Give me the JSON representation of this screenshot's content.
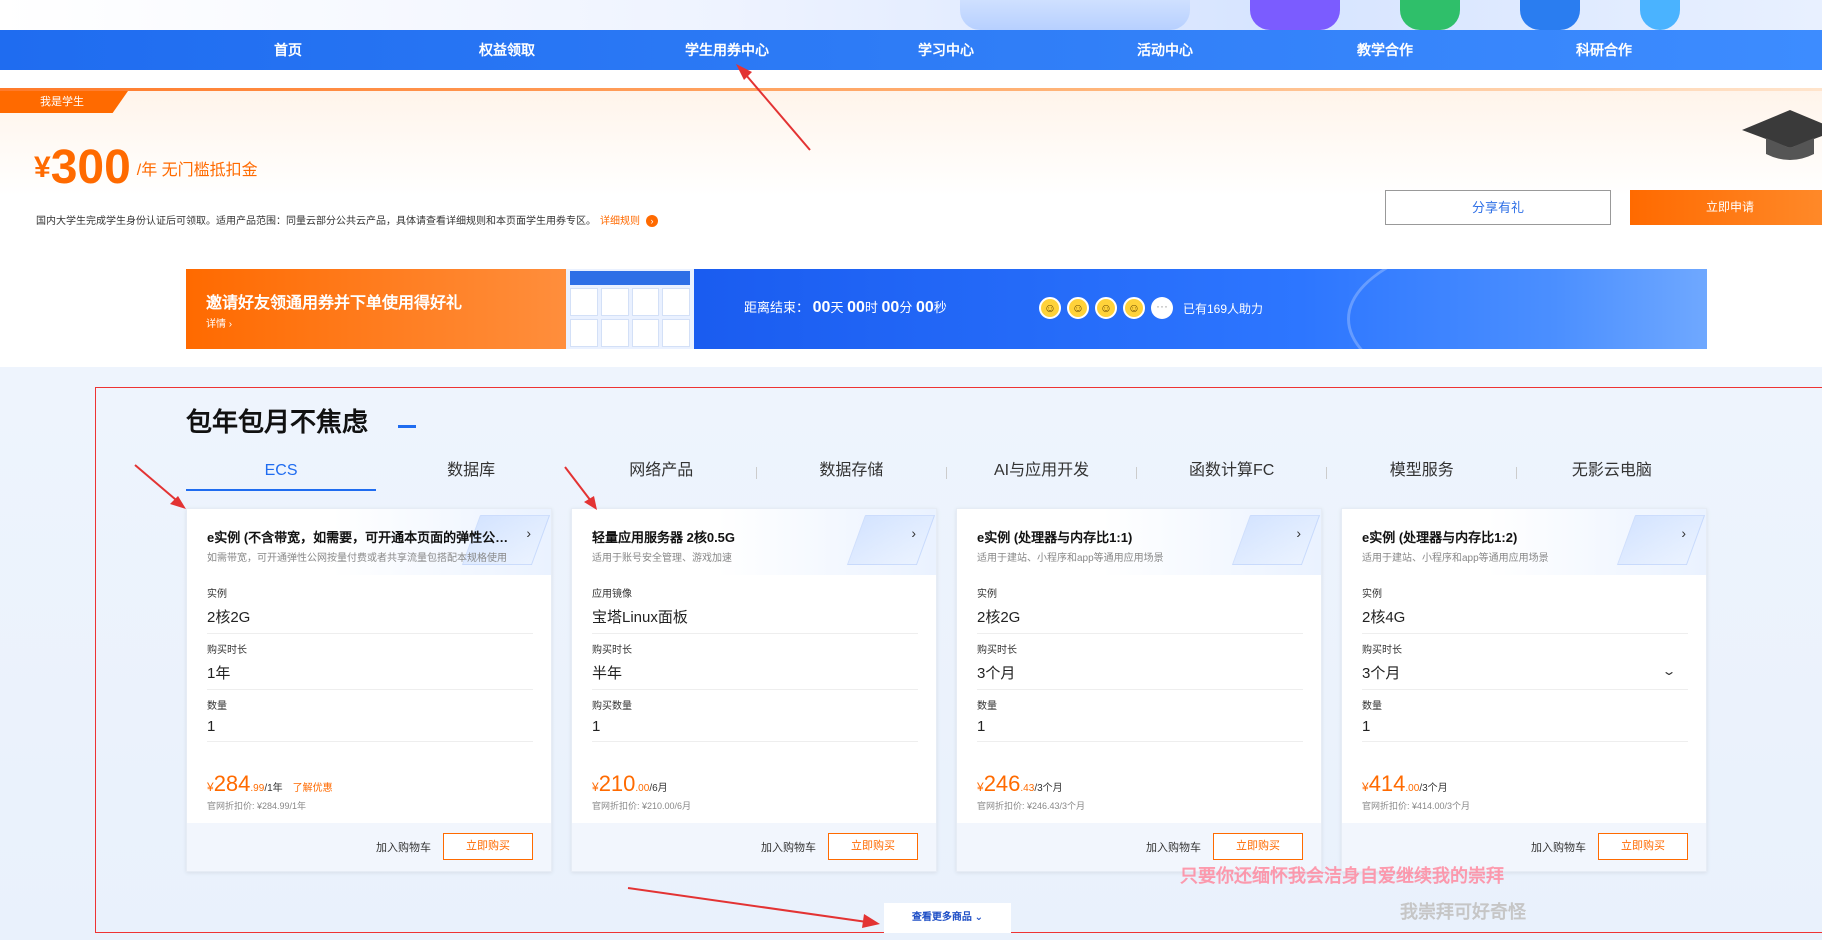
{
  "nav": {
    "items": [
      "首页",
      "权益领取",
      "学生用券中心",
      "学习中心",
      "活动中心",
      "教学合作",
      "科研合作"
    ]
  },
  "student": {
    "tag": "我是学生",
    "currency": "¥",
    "amount": "300",
    "unit": "/年 无门槛抵扣金",
    "desc": "国内大学生完成学生身份认证后可领取。适用产品范围：同量云部分公共云产品，具体请查看详细规则和本页面学生用券专区。",
    "rule_link": "详细规则",
    "share_label": "分享有礼",
    "apply_label": "立即申请"
  },
  "invite": {
    "title": "邀请好友领通用券并下单使用得好礼",
    "detail": "详情 ›",
    "countdown_prefix": "距离结束：",
    "days": "00",
    "days_unit": "天",
    "hours": "00",
    "hours_unit": "时",
    "minutes": "00",
    "minutes_unit": "分",
    "seconds": "00",
    "seconds_unit": "秒",
    "helpers_text": "已有169人助力",
    "more_glyph": "···"
  },
  "section": {
    "title": "包年包月不焦虑",
    "tabs": [
      "ECS",
      "数据库",
      "网络产品",
      "数据存储",
      "AI与应用开发",
      "函数计算FC",
      "模型服务",
      "无影云电脑"
    ],
    "active_tab": 0,
    "more_label": "查看更多商品 ⌄"
  },
  "cards": [
    {
      "title": "e实例 (不含带宽，如需要，可开通本页面的弹性公网IP)",
      "subtitle": "如需带宽，可开通弹性公网按量付费或者共享流量包搭配本规格使用",
      "f1_label": "实例",
      "f1_value": "2核2G",
      "f2_label": "购买时长",
      "f2_value": "1年",
      "f3_label": "数量",
      "f3_value": "1",
      "price_yen": "¥",
      "price_int": "284",
      "price_dec": ".99",
      "price_per": "/1年",
      "promo": "了解优惠",
      "orig": "官网折扣价: ¥284.99/1年",
      "cart": "加入购物车",
      "buy": "立即购买"
    },
    {
      "title": "轻量应用服务器 2核0.5G",
      "subtitle": "适用于账号安全管理、游戏加速",
      "f1_label": "应用镜像",
      "f1_value": "宝塔Linux面板",
      "f2_label": "购买时长",
      "f2_value": "半年",
      "f3_label": "购买数量",
      "f3_value": "1",
      "price_yen": "¥",
      "price_int": "210",
      "price_dec": ".00",
      "price_per": "/6月",
      "promo": "",
      "orig": "官网折扣价: ¥210.00/6月",
      "cart": "加入购物车",
      "buy": "立即购买"
    },
    {
      "title": "e实例 (处理器与内存比1:1)",
      "subtitle": "适用于建站、小程序和app等通用应用场景",
      "f1_label": "实例",
      "f1_value": "2核2G",
      "f2_label": "购买时长",
      "f2_value": "3个月",
      "f3_label": "数量",
      "f3_value": "1",
      "price_yen": "¥",
      "price_int": "246",
      "price_dec": ".43",
      "price_per": "/3个月",
      "promo": "",
      "orig": "官网折扣价: ¥246.43/3个月",
      "cart": "加入购物车",
      "buy": "立即购买"
    },
    {
      "title": "e实例 (处理器与内存比1:2)",
      "subtitle": "适用于建站、小程序和app等通用应用场景",
      "f1_label": "实例",
      "f1_value": "2核4G",
      "f2_label": "购买时长",
      "f2_value": "3个月",
      "f3_label": "数量",
      "f3_value": "1",
      "price_yen": "¥",
      "price_int": "414",
      "price_dec": ".00",
      "price_per": "/3个月",
      "promo": "",
      "orig": "官网折扣价: ¥414.00/3个月",
      "cart": "加入购物车",
      "buy": "立即购买"
    }
  ],
  "overlays": {
    "line1": "只要你还缅怀我会洁身自爱继续我的崇拜",
    "line2": "我崇拜可好奇怪"
  },
  "colors": {
    "brand_blue": "#1f6cf0",
    "accent_orange": "#ff6a00",
    "annotation_red": "#e33333"
  }
}
